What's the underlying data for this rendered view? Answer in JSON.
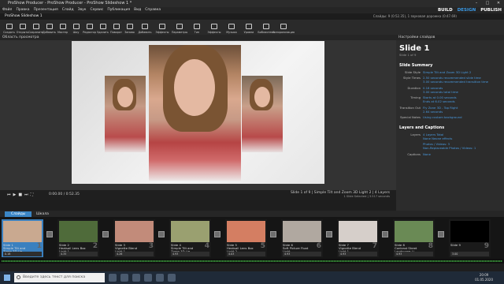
{
  "app": {
    "title": "ProShow Producer - ProShow Producer - ProShow Slideshow 1 *"
  },
  "window_controls": [
    "–",
    "□",
    "✕"
  ],
  "menu": [
    "Файл",
    "Правка",
    "Презентация",
    "Слайд",
    "Звук",
    "Сервис",
    "Публикация",
    "Вид",
    "Справка"
  ],
  "modes": {
    "build": "BUILD",
    "design": "DESIGN",
    "publish": "PUBLISH",
    "active": "DESIGN",
    "build_color": "#ffffff",
    "design_color": "#3b9be8",
    "publish_color": "#ffffff"
  },
  "tabs": {
    "slideshow": "ProShow Slideshow 1",
    "info": "Слайды: 9 (0:52.35), 1 звуковая дорожка (0:47.69)"
  },
  "toolbar": [
    "Создать",
    "Открыть",
    "Сохранить",
    "Добавить",
    "Мастер",
    "Шоу",
    "Редактор",
    "Удалить",
    "Поворот",
    "Заново",
    "Добавить",
    "Эффекты",
    "Параметры",
    "Тип",
    "Эффекты",
    "Музыка",
    "Уровни",
    "Библиотека",
    "Синхронизация"
  ],
  "toolbar_icons": [
    "new-icon",
    "open-icon",
    "save-icon",
    "add-icon",
    "wizard-icon",
    "show-icon",
    "editor-icon",
    "delete-icon",
    "rotate-icon",
    "redo-icon",
    "add-slide-icon",
    "effects-icon",
    "layers-icon",
    "fx-icon",
    "music-icon",
    "sound-icon",
    "levels-icon",
    "library-icon",
    "sync-icon"
  ],
  "preview": {
    "header": "Область просмотра",
    "timecode": "0:00.00 / 0:52.35",
    "slide_label": "Slide 1 of 9  |  Simple Tilt and Zoom 3D Light 2  |  4 Layers",
    "slide_sub": "1 Slide Selected  |  3.517 seconds"
  },
  "slide_options": {
    "header": "Настройки слайдов",
    "title": "Slide 1",
    "subtitle": "Slide 1 of 9",
    "summary_title": "Slide Summary",
    "summary": [
      {
        "k": "Slide Style",
        "v": "Simple Tilt and Zoom 3D Light 2"
      },
      {
        "k": "Style Times",
        "v": "2.50 seconds recommended slide time",
        "v2": "3.00 seconds recommended transition time"
      },
      {
        "k": "Duration",
        "v": "0.18 seconds",
        "v2": "3.00 seconds total time"
      },
      {
        "k": "Timing",
        "v": "Starts at 0.00 seconds",
        "v2": "Ends at 6.02 seconds"
      },
      {
        "k": "Transition Out",
        "v": "Fly Zone 3D - Top Right",
        "v2": "2.64 seconds"
      },
      {
        "k": "Special Notes",
        "v": "Using custom background"
      }
    ],
    "layers_title": "Layers and Captions",
    "layers": [
      {
        "k": "Layers",
        "v": "4 Layers Total",
        "v2": "None Neone effects"
      },
      {
        "k": "",
        "v": "Photos / Videos: 3",
        "v2": "Non-Replaceable Photos / Videos: 1"
      },
      {
        "k": "Captions",
        "v": "None"
      }
    ]
  },
  "timeline": {
    "tab_slides": "Слайды",
    "tab_audio": "Шкала",
    "slides": [
      {
        "num": "1",
        "name": "Slide 1",
        "style": "Simple Tilt and Zoom 3D Lig...",
        "time": "0.18",
        "selected": true
      },
      {
        "num": "2",
        "name": "Slide 2",
        "style": "Heatsail Lens Box Light 1",
        "time": "4.35",
        "selected": false
      },
      {
        "num": "3",
        "name": "Slide 3",
        "style": "Vignette Blend Light 1",
        "time": "4.26",
        "selected": false
      },
      {
        "num": "4",
        "name": "Slide 4",
        "style": "Simple Tilt and Zoom 3D Lig...",
        "time": "4.93",
        "selected": false
      },
      {
        "num": "5",
        "name": "Slide 5",
        "style": "Heatsail Lens Box Light 2",
        "time": "4.03",
        "selected": false
      },
      {
        "num": "6",
        "name": "Slide 6",
        "style": "Soft Picture Float Light",
        "time": "4.93",
        "selected": false
      },
      {
        "num": "7",
        "name": "Slide 7",
        "style": "Vignette Blend Light 1",
        "time": "4.93",
        "selected": false
      },
      {
        "num": "8",
        "name": "Slide 8",
        "style": "Contrast Sheet Landscape Li...",
        "time": "4.93",
        "selected": false
      },
      {
        "num": "9",
        "name": "Slide 9",
        "style": "",
        "time": "3.00",
        "selected": false
      }
    ]
  },
  "taskbar": {
    "search": "Введите здесь текст для поиска",
    "time": "20:09",
    "date": "01.05.2020"
  }
}
